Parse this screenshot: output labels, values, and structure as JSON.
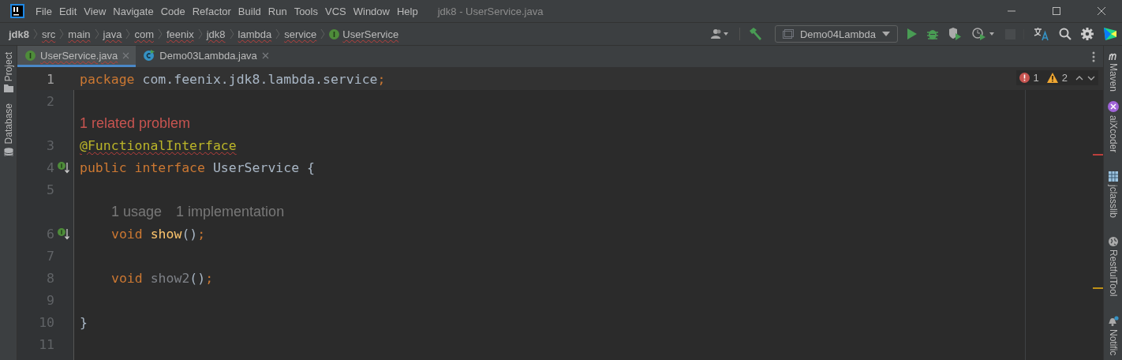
{
  "window": {
    "title": "jdk8 - UserService.java"
  },
  "menu": [
    "File",
    "Edit",
    "View",
    "Navigate",
    "Code",
    "Refactor",
    "Build",
    "Run",
    "Tools",
    "VCS",
    "Window",
    "Help"
  ],
  "breadcrumbs": [
    {
      "text": "jdk8",
      "kind": "project",
      "underlined": false
    },
    {
      "text": "src",
      "kind": "folder",
      "underlined": true
    },
    {
      "text": "main",
      "kind": "folder",
      "underlined": true
    },
    {
      "text": "java",
      "kind": "folder",
      "underlined": true
    },
    {
      "text": "com",
      "kind": "folder",
      "underlined": true
    },
    {
      "text": "feenix",
      "kind": "folder",
      "underlined": true
    },
    {
      "text": "jdk8",
      "kind": "folder",
      "underlined": true
    },
    {
      "text": "lambda",
      "kind": "folder",
      "underlined": true
    },
    {
      "text": "service",
      "kind": "folder",
      "underlined": true
    },
    {
      "text": "UserService",
      "kind": "interface",
      "underlined": true
    }
  ],
  "toolbar": [
    {
      "kind": "user",
      "disabled": false
    },
    {
      "kind": "build",
      "disabled": false
    },
    {
      "kind": "config",
      "label": "Demo04Lambda",
      "disabled": false
    },
    {
      "kind": "run",
      "disabled": false
    },
    {
      "kind": "debug",
      "disabled": false
    },
    {
      "kind": "coverage",
      "disabled": false
    },
    {
      "kind": "profile",
      "disabled": false
    },
    {
      "kind": "stop",
      "disabled": true
    },
    {
      "kind": "translate",
      "disabled": false
    },
    {
      "kind": "search",
      "disabled": false
    },
    {
      "kind": "settings",
      "disabled": false
    },
    {
      "kind": "plugin",
      "disabled": false
    }
  ],
  "tabs": [
    {
      "label": "UserService.java",
      "kind": "interface",
      "selected": true,
      "underlined": true
    },
    {
      "label": "Demo03Lambda.java",
      "kind": "class",
      "selected": false,
      "underlined": false
    }
  ],
  "left_tools": [
    {
      "label": "Project",
      "kind": "folder"
    },
    {
      "label": "Database",
      "kind": "database"
    }
  ],
  "right_tools": [
    {
      "label": "Maven",
      "kind": "maven"
    },
    {
      "label": "aiXcoder",
      "kind": "aixcoder"
    },
    {
      "label": "jclasslib",
      "kind": "jclasslib"
    },
    {
      "label": "RestfulTool",
      "kind": "globe"
    },
    {
      "label": "Notific",
      "kind": "bell"
    }
  ],
  "inspections": {
    "errors": "1",
    "warnings": "2"
  },
  "lines": [
    {
      "kind": "code",
      "number": "1",
      "current": true,
      "indented": false,
      "marker": false,
      "tokens": [
        {
          "text": "package",
          "kind": "keyword"
        },
        {
          "text": " com.feenix.jdk8.lambda.service",
          "kind": "plain"
        },
        {
          "text": ";",
          "kind": "keyword"
        }
      ]
    },
    {
      "kind": "code",
      "number": "2",
      "current": false,
      "marker": false
    },
    {
      "kind": "problem",
      "text": "1 related problem"
    },
    {
      "kind": "code",
      "number": "3",
      "current": false,
      "indented": false,
      "marker": false,
      "tokens": [
        {
          "text": "@FunctionalInterface",
          "kind": "annotation",
          "underlined": true
        }
      ]
    },
    {
      "kind": "code",
      "number": "4",
      "current": false,
      "indented": false,
      "marker": true,
      "tokens": [
        {
          "text": "public interface",
          "kind": "keyword"
        },
        {
          "text": " UserService {",
          "kind": "plain"
        }
      ]
    },
    {
      "kind": "code",
      "number": "5",
      "current": false,
      "marker": false
    },
    {
      "kind": "hints",
      "indented": true,
      "items": [
        "1 usage",
        "1 implementation"
      ]
    },
    {
      "kind": "code",
      "number": "6",
      "current": false,
      "indented": true,
      "marker": true,
      "tokens": [
        {
          "text": "void ",
          "kind": "keyword"
        },
        {
          "text": "show",
          "kind": "method"
        },
        {
          "text": "()",
          "kind": "plain"
        },
        {
          "text": ";",
          "kind": "keyword"
        }
      ]
    },
    {
      "kind": "code",
      "number": "7",
      "current": false,
      "marker": false
    },
    {
      "kind": "code",
      "number": "8",
      "current": false,
      "indented": true,
      "marker": false,
      "tokens": [
        {
          "text": "void ",
          "kind": "keyword"
        },
        {
          "text": "show2",
          "kind": "unused"
        },
        {
          "text": "()",
          "kind": "plain"
        },
        {
          "text": ";",
          "kind": "keyword"
        }
      ]
    },
    {
      "kind": "code",
      "number": "9",
      "current": false,
      "marker": false
    },
    {
      "kind": "code",
      "number": "10",
      "current": false,
      "indented": false,
      "marker": false,
      "tokens": [
        {
          "text": "}",
          "kind": "plain"
        }
      ]
    },
    {
      "kind": "code",
      "number": "11",
      "current": false,
      "marker": false
    }
  ]
}
